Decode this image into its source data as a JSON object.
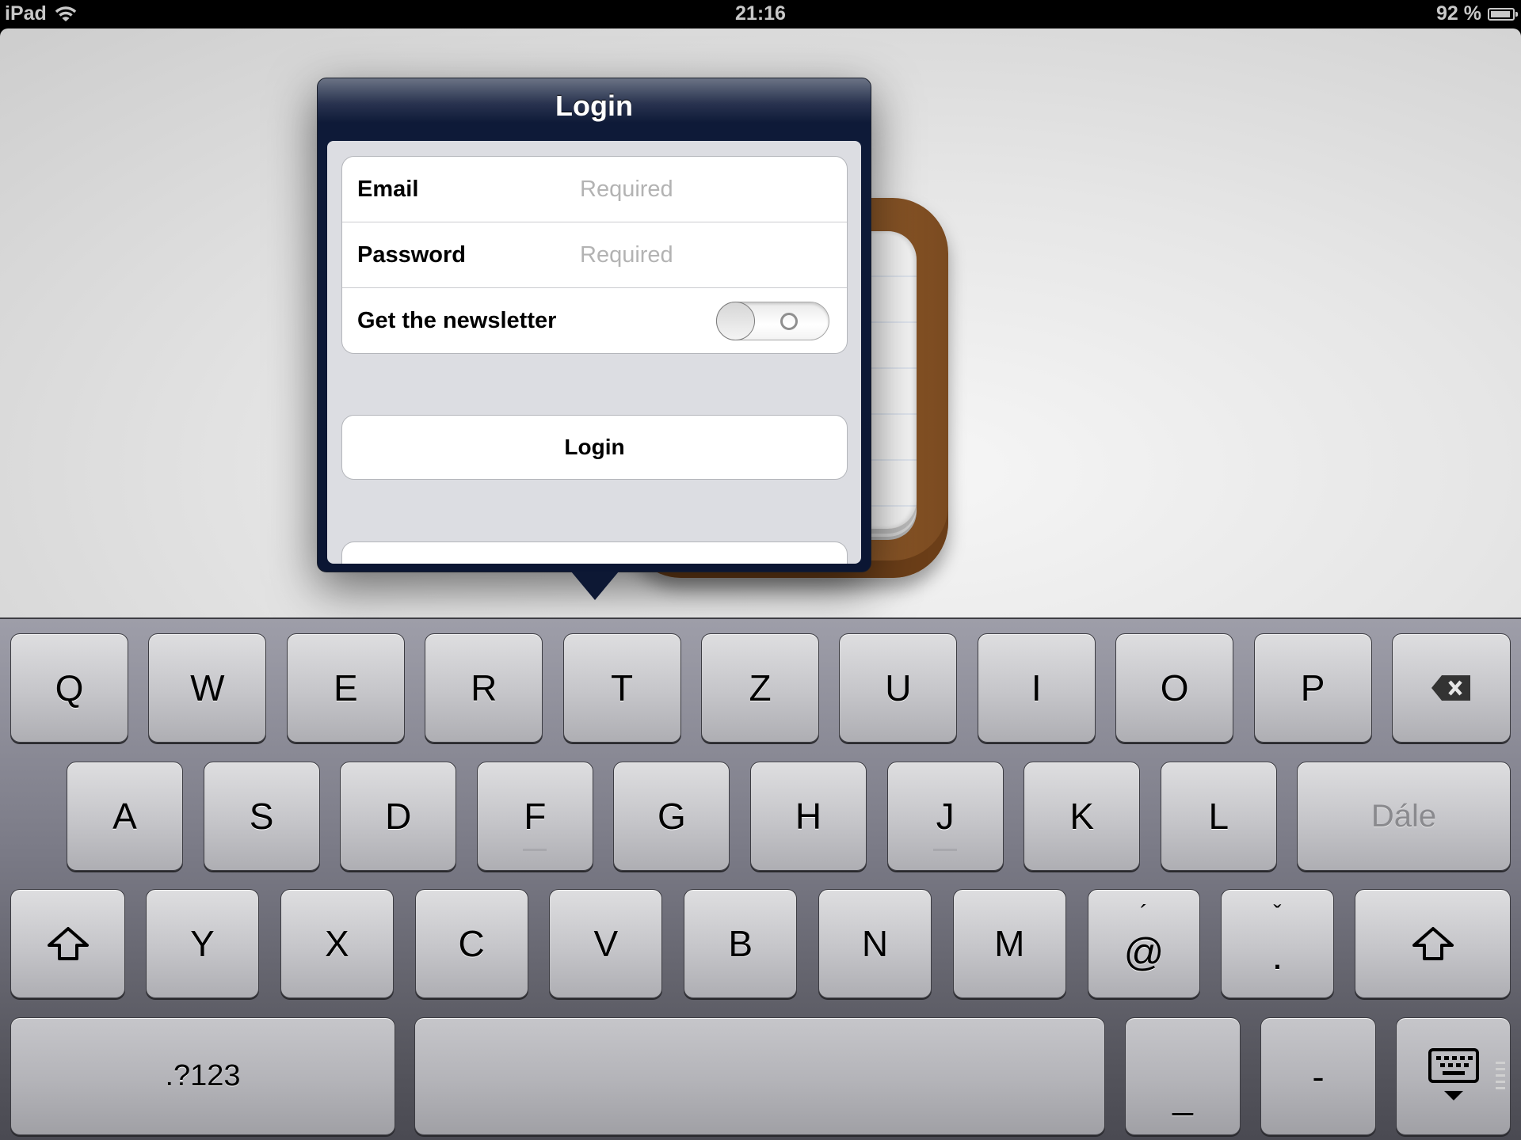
{
  "status_bar": {
    "device": "iPad",
    "time": "21:16",
    "battery_percent": "92 %",
    "battery_level": 0.92,
    "wifi_icon": "wifi-icon",
    "battery_icon": "battery-icon"
  },
  "popover": {
    "title": "Login",
    "form": {
      "email": {
        "label": "Email",
        "value": "",
        "placeholder": "Required"
      },
      "password": {
        "label": "Password",
        "value": "",
        "placeholder": "Required"
      },
      "newsletter": {
        "label": "Get the newsletter",
        "on": false
      }
    },
    "login_button": "Login"
  },
  "keyboard": {
    "row1": [
      "Q",
      "W",
      "E",
      "R",
      "T",
      "Z",
      "U",
      "I",
      "O",
      "P"
    ],
    "backspace_icon": "backspace-icon",
    "row2": [
      "A",
      "S",
      "D",
      "F",
      "G",
      "H",
      "J",
      "K",
      "L"
    ],
    "return_label": "Dále",
    "shift_icon": "shift-icon",
    "row3": [
      "Y",
      "X",
      "C",
      "V",
      "B",
      "N",
      "M"
    ],
    "at_key": {
      "main": "@",
      "alt": "´"
    },
    "dot_key": {
      "main": ".",
      "alt": "ˇ"
    },
    "numbers_label": ".?123",
    "underscore_label": "_",
    "hyphen_label": "-",
    "dismiss_icon": "keyboard-dismiss-icon"
  }
}
